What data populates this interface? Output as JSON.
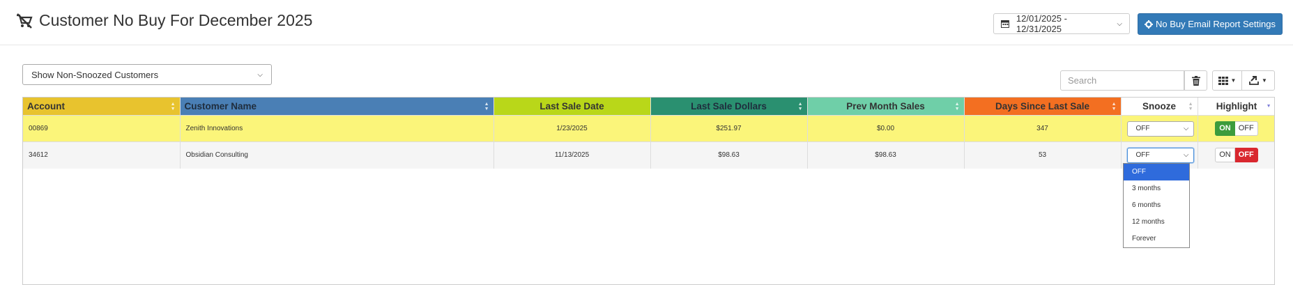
{
  "header": {
    "title": "Customer No Buy For December 2025",
    "date_range": "12/01/2025 - 12/31/2025",
    "settings_button": "No Buy Email Report Settings"
  },
  "toolbar": {
    "filter_value": "Show Non-Snoozed Customers",
    "search_placeholder": "Search"
  },
  "table": {
    "columns": [
      {
        "label": "Account",
        "bg": "#e8c32e",
        "color": "#333333"
      },
      {
        "label": "Customer Name",
        "bg": "#4a7fb5",
        "color": "#1f2d3d"
      },
      {
        "label": "Last Sale Date",
        "bg": "#b9d719",
        "color": "#333333"
      },
      {
        "label": "Last Sale Dollars",
        "bg": "#2a9070",
        "color": "#1f2d3d"
      },
      {
        "label": "Prev Month Sales",
        "bg": "#6fcfa8",
        "color": "#333333"
      },
      {
        "label": "Days Since Last Sale",
        "bg": "#f36f21",
        "color": "#333333"
      },
      {
        "label": "Snooze",
        "bg": "#ffffff",
        "color": "#333333"
      },
      {
        "label": "Highlight",
        "bg": "#ffffff",
        "color": "#333333"
      }
    ],
    "rows": [
      {
        "account": "00869",
        "name": "Zenith Innovations",
        "last_sale_date": "1/23/2025",
        "last_sale_dollars": "$251.97",
        "prev_month_sales": "$0.00",
        "days_since": "347",
        "snooze": "OFF",
        "highlight_on": "ON",
        "highlight_off": "OFF",
        "highlighted": true
      },
      {
        "account": "34612",
        "name": "Obsidian Consulting",
        "last_sale_date": "11/13/2025",
        "last_sale_dollars": "$98.63",
        "prev_month_sales": "$98.63",
        "days_since": "53",
        "snooze": "OFF",
        "highlight_on": "ON",
        "highlight_off": "OFF",
        "highlighted": false
      }
    ]
  },
  "snooze_dropdown": {
    "options": [
      "OFF",
      "3 months",
      "6 months",
      "12 months",
      "Forever"
    ],
    "selected": "OFF"
  },
  "icons": {
    "title_icon": "no-cart-icon",
    "date_icon": "calendar-icon",
    "settings_icon": "gear-icon",
    "trash_icon": "trash-icon",
    "columns_icon": "grid-icon",
    "export_icon": "export-icon"
  }
}
